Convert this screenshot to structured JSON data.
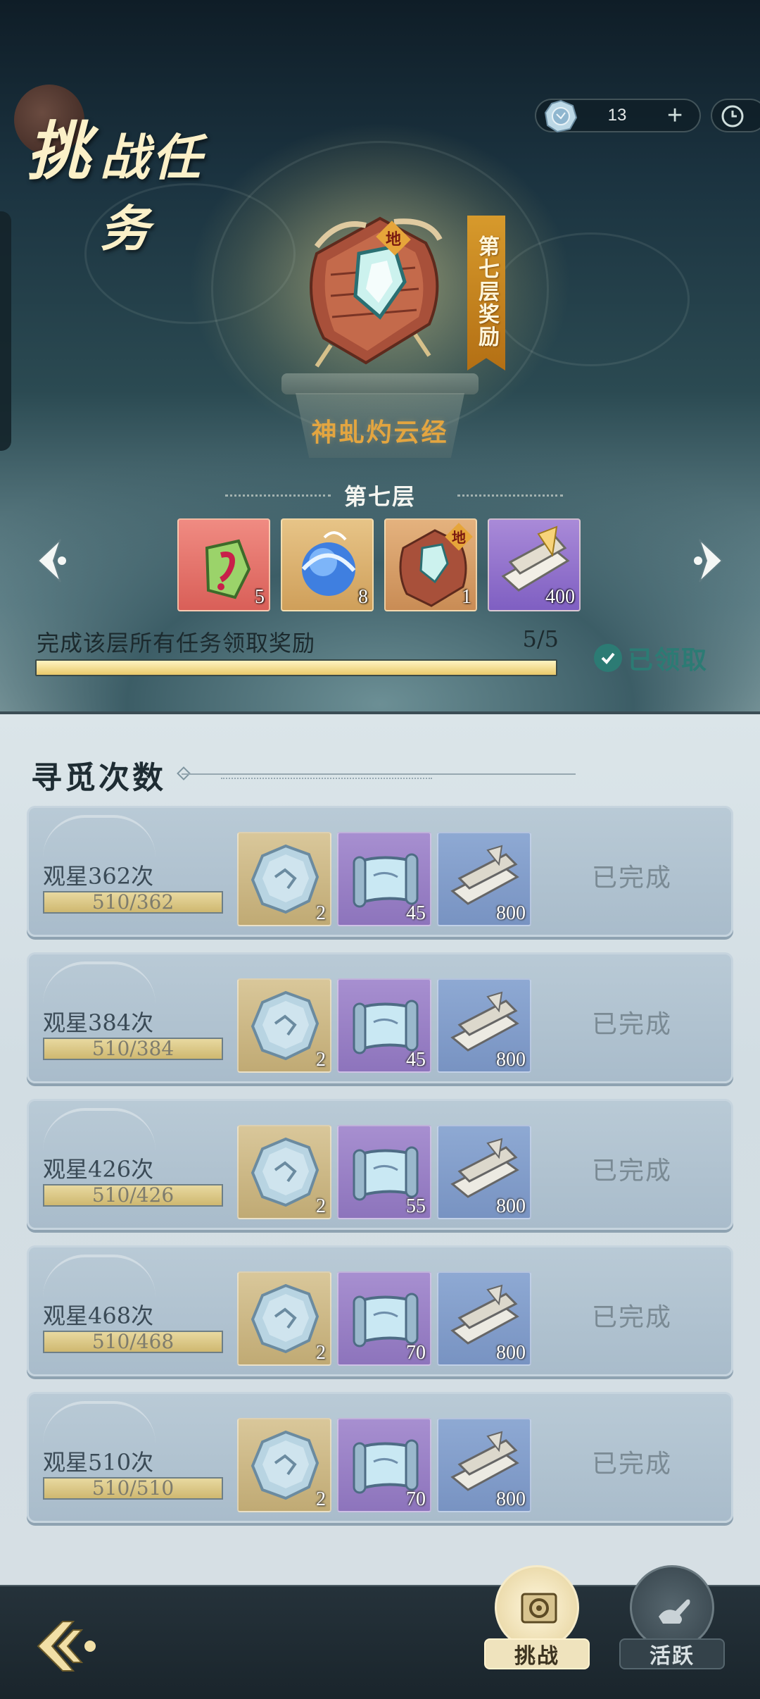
{
  "header": {
    "title_first_char": "挑",
    "title_rest": "战任务",
    "currency": {
      "icon": "star-coin-icon",
      "value": "13",
      "plus_label": "+"
    },
    "clock_icon": "clock-icon"
  },
  "featured": {
    "banner_text": "第七层奖励",
    "item_badge": "地",
    "item_name": "神虬灼云经",
    "floor_label": "第七层",
    "rewards": [
      {
        "icon": "green-talisman-icon",
        "qty": "5",
        "bg": "#e8726c"
      },
      {
        "icon": "blue-orb-icon",
        "qty": "8",
        "bg": "#d9b070"
      },
      {
        "icon": "red-book-icon",
        "qty": "1",
        "bg": "#d9a56c",
        "badge": "地"
      },
      {
        "icon": "scroll-bundle-icon",
        "qty": "400",
        "bg": "#8a6cc8"
      }
    ],
    "task_text": "完成该层所有任务领取奖励",
    "task_progress": "5/5",
    "task_fraction": 1.0,
    "claimed_label": "已领取"
  },
  "search": {
    "title": "寻觅次数",
    "rows": [
      {
        "label": "观星362次",
        "progress": "510/362",
        "fraction": 1.0,
        "items": [
          {
            "icon": "star-coin-icon",
            "qty": "2"
          },
          {
            "icon": "purple-scroll-icon",
            "qty": "45"
          },
          {
            "icon": "scroll-bundle-icon",
            "qty": "800"
          }
        ],
        "status": "已完成"
      },
      {
        "label": "观星384次",
        "progress": "510/384",
        "fraction": 1.0,
        "items": [
          {
            "icon": "star-coin-icon",
            "qty": "2"
          },
          {
            "icon": "purple-scroll-icon",
            "qty": "45"
          },
          {
            "icon": "scroll-bundle-icon",
            "qty": "800"
          }
        ],
        "status": "已完成"
      },
      {
        "label": "观星426次",
        "progress": "510/426",
        "fraction": 1.0,
        "items": [
          {
            "icon": "star-coin-icon",
            "qty": "2"
          },
          {
            "icon": "purple-scroll-icon",
            "qty": "55"
          },
          {
            "icon": "scroll-bundle-icon",
            "qty": "800"
          }
        ],
        "status": "已完成"
      },
      {
        "label": "观星468次",
        "progress": "510/468",
        "fraction": 1.0,
        "items": [
          {
            "icon": "star-coin-icon",
            "qty": "2"
          },
          {
            "icon": "purple-scroll-icon",
            "qty": "70"
          },
          {
            "icon": "scroll-bundle-icon",
            "qty": "800"
          }
        ],
        "status": "已完成"
      },
      {
        "label": "观星510次",
        "progress": "510/510",
        "fraction": 1.0,
        "items": [
          {
            "icon": "star-coin-icon",
            "qty": "2"
          },
          {
            "icon": "purple-scroll-icon",
            "qty": "70"
          },
          {
            "icon": "scroll-bundle-icon",
            "qty": "800"
          }
        ],
        "status": "已完成"
      }
    ]
  },
  "nav": {
    "back_icon": "back-arrow-icon",
    "tabs": [
      {
        "label": "挑战",
        "icon": "gear-scroll-icon",
        "active": true
      },
      {
        "label": "活跃",
        "icon": "hand-gesture-icon",
        "active": false
      }
    ]
  },
  "colors": {
    "accent_gold": "#e3a540",
    "claimed_teal": "#2c7b74",
    "banner_orange": "#c9861f"
  }
}
